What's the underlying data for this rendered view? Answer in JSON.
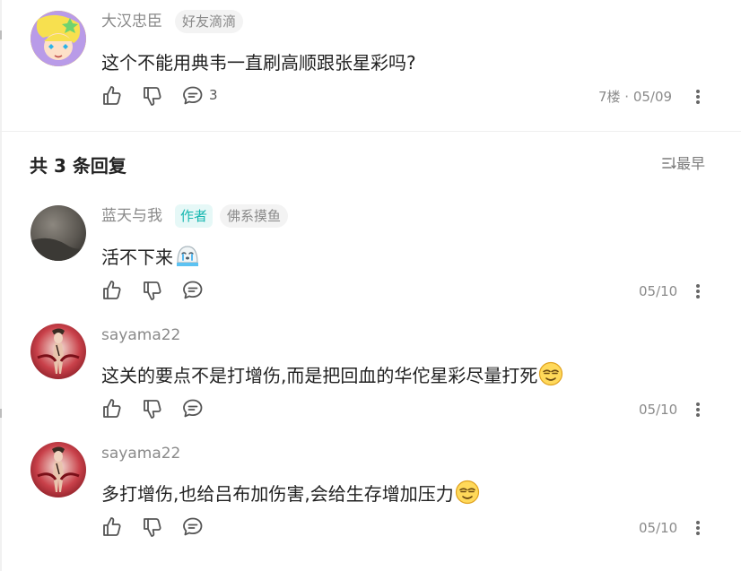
{
  "main_comment": {
    "username": "大汉忠臣",
    "badge": "好友滴滴",
    "text": "这个不能用典韦一直刷高顺跟张星彩吗?",
    "reply_count": "3",
    "meta": "7楼 · 05/09"
  },
  "replies_section": {
    "title": "共 3 条回复",
    "sort_label": "最早"
  },
  "replies": [
    {
      "username": "蓝天与我",
      "author_tag": "作者",
      "badge": "佛系摸鱼",
      "text": "活不下来",
      "emoji": "crying-face-icon",
      "date": "05/10"
    },
    {
      "username": "sayama22",
      "text": "这关的要点不是打增伤,而是把回血的华佗星彩尽量打死",
      "emoji": "smug-face-icon",
      "date": "05/10"
    },
    {
      "username": "sayama22",
      "text": "多打增伤,也给吕布加伤害,会给生存增加压力",
      "emoji": "smug-face-icon",
      "date": "05/10"
    }
  ],
  "colors": {
    "accent": "#17b7b0",
    "muted": "#8a8a8a",
    "text": "#222222"
  }
}
